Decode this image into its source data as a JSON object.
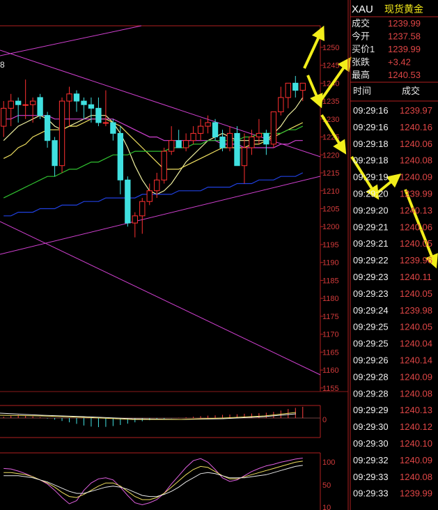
{
  "header": {
    "symbol": "XAU",
    "name": "现货黄金"
  },
  "quote": [
    {
      "label": "成交",
      "value": "1239.99"
    },
    {
      "label": "今开",
      "value": "1237.58"
    },
    {
      "label": "买价1",
      "value": "1239.99"
    },
    {
      "label": "张跌",
      "value": "+3.42"
    },
    {
      "label": "最高",
      "value": "1240.53"
    }
  ],
  "trades_header": {
    "time": "时间",
    "price": "成交"
  },
  "trades": [
    {
      "time": "09:29:16",
      "price": "1239.97"
    },
    {
      "time": "09:29:16",
      "price": "1240.16"
    },
    {
      "time": "09:29:18",
      "price": "1240.06"
    },
    {
      "time": "09:29:18",
      "price": "1240.08"
    },
    {
      "time": "09:29:19",
      "price": "1240.09"
    },
    {
      "time": "09:29:20",
      "price": "1239.99"
    },
    {
      "time": "09:29:20",
      "price": "1240.13"
    },
    {
      "time": "09:29:21",
      "price": "1240.06"
    },
    {
      "time": "09:29:21",
      "price": "1240.05"
    },
    {
      "time": "09:29:22",
      "price": "1239.96"
    },
    {
      "time": "09:29:23",
      "price": "1240.11"
    },
    {
      "time": "09:29:23",
      "price": "1240.05"
    },
    {
      "time": "09:29:24",
      "price": "1239.98"
    },
    {
      "time": "09:29:25",
      "price": "1240.05"
    },
    {
      "time": "09:29:25",
      "price": "1240.04"
    },
    {
      "time": "09:29:26",
      "price": "1240.14"
    },
    {
      "time": "09:29:28",
      "price": "1240.09"
    },
    {
      "time": "09:29:28",
      "price": "1240.08"
    },
    {
      "time": "09:29:29",
      "price": "1240.13"
    },
    {
      "time": "09:29:30",
      "price": "1240.12"
    },
    {
      "time": "09:29:30",
      "price": "1240.10"
    },
    {
      "time": "09:29:32",
      "price": "1240.09"
    },
    {
      "time": "09:29:33",
      "price": "1240.08"
    },
    {
      "time": "09:29:33",
      "price": "1239.99"
    }
  ],
  "chart_data": [
    {
      "type": "candlestick",
      "price_axis": {
        "ylim": [
          1154,
          1256
        ],
        "ticks": [
          "1250",
          "1245",
          "1240",
          "1235",
          "1230",
          "1225",
          "1220",
          "1215",
          "1210",
          "1205",
          "1200",
          "1195",
          "1190",
          "1185",
          "1180",
          "1175",
          "1170",
          "1165",
          "1160",
          "1155"
        ],
        "tick_values": [
          1250,
          1245,
          1240,
          1235,
          1230,
          1225,
          1220,
          1215,
          1210,
          1205,
          1200,
          1195,
          1190,
          1185,
          1180,
          1175,
          1170,
          1165,
          1160,
          1155
        ]
      },
      "partial_label": "8",
      "candles": [
        {
          "o": 1228,
          "h": 1235,
          "l": 1225,
          "c": 1233
        },
        {
          "o": 1233,
          "h": 1237,
          "l": 1228,
          "c": 1235
        },
        {
          "o": 1235,
          "h": 1236,
          "l": 1229,
          "c": 1234
        },
        {
          "o": 1234,
          "h": 1241,
          "l": 1230,
          "c": 1234
        },
        {
          "o": 1234,
          "h": 1236,
          "l": 1229,
          "c": 1235
        },
        {
          "o": 1236,
          "h": 1237,
          "l": 1230,
          "c": 1231
        },
        {
          "o": 1231,
          "h": 1232,
          "l": 1222,
          "c": 1224
        },
        {
          "o": 1224,
          "h": 1225,
          "l": 1214,
          "c": 1217
        },
        {
          "o": 1217,
          "h": 1236,
          "l": 1215,
          "c": 1235
        },
        {
          "o": 1235,
          "h": 1239,
          "l": 1228,
          "c": 1237
        },
        {
          "o": 1237,
          "h": 1238,
          "l": 1232,
          "c": 1235
        },
        {
          "o": 1235,
          "h": 1236,
          "l": 1230,
          "c": 1234
        },
        {
          "o": 1234,
          "h": 1236,
          "l": 1229,
          "c": 1233
        },
        {
          "o": 1233,
          "h": 1236,
          "l": 1228,
          "c": 1229
        },
        {
          "o": 1229,
          "h": 1238,
          "l": 1228,
          "c": 1229
        },
        {
          "o": 1229,
          "h": 1230,
          "l": 1224,
          "c": 1226
        },
        {
          "o": 1226,
          "h": 1228,
          "l": 1209,
          "c": 1213
        },
        {
          "o": 1213,
          "h": 1214,
          "l": 1200,
          "c": 1201
        },
        {
          "o": 1201,
          "h": 1204,
          "l": 1197,
          "c": 1203
        },
        {
          "o": 1203,
          "h": 1208,
          "l": 1198,
          "c": 1207
        },
        {
          "o": 1207,
          "h": 1212,
          "l": 1206,
          "c": 1210
        },
        {
          "o": 1210,
          "h": 1215,
          "l": 1208,
          "c": 1213
        },
        {
          "o": 1213,
          "h": 1222,
          "l": 1212,
          "c": 1221
        },
        {
          "o": 1221,
          "h": 1228,
          "l": 1220,
          "c": 1224
        },
        {
          "o": 1224,
          "h": 1227,
          "l": 1222,
          "c": 1222
        },
        {
          "o": 1222,
          "h": 1226,
          "l": 1221,
          "c": 1224
        },
        {
          "o": 1224,
          "h": 1228,
          "l": 1223,
          "c": 1226
        },
        {
          "o": 1226,
          "h": 1230,
          "l": 1224,
          "c": 1228
        },
        {
          "o": 1228,
          "h": 1231,
          "l": 1226,
          "c": 1229
        },
        {
          "o": 1229,
          "h": 1230,
          "l": 1224,
          "c": 1225
        },
        {
          "o": 1225,
          "h": 1227,
          "l": 1221,
          "c": 1222
        },
        {
          "o": 1222,
          "h": 1228,
          "l": 1221,
          "c": 1226
        },
        {
          "o": 1226,
          "h": 1228,
          "l": 1217,
          "c": 1217
        },
        {
          "o": 1217,
          "h": 1226,
          "l": 1212,
          "c": 1222
        },
        {
          "o": 1222,
          "h": 1227,
          "l": 1220,
          "c": 1225
        },
        {
          "o": 1225,
          "h": 1230,
          "l": 1223,
          "c": 1226
        },
        {
          "o": 1226,
          "h": 1227,
          "l": 1220,
          "c": 1223
        },
        {
          "o": 1223,
          "h": 1232,
          "l": 1222,
          "c": 1232
        },
        {
          "o": 1232,
          "h": 1239,
          "l": 1231,
          "c": 1236
        },
        {
          "o": 1236,
          "h": 1240,
          "l": 1233,
          "c": 1240
        },
        {
          "o": 1240,
          "h": 1242,
          "l": 1236,
          "c": 1238
        },
        {
          "o": 1238,
          "h": 1240,
          "l": 1235,
          "c": 1240
        }
      ],
      "moving_averages": [
        {
          "color": "#f0f0a0",
          "values": [
            1224,
            1226,
            1228,
            1229,
            1230,
            1231,
            1230,
            1228,
            1227,
            1228,
            1229,
            1230,
            1231,
            1231,
            1231,
            1229,
            1226,
            1222,
            1217,
            1213,
            1210,
            1209,
            1210,
            1212,
            1215,
            1218,
            1220,
            1222,
            1224,
            1225,
            1226,
            1225,
            1224,
            1224,
            1224,
            1224,
            1224,
            1226,
            1228,
            1231,
            1233,
            1236
          ]
        },
        {
          "color": "#f0e060",
          "values": [
            1219,
            1220,
            1222,
            1223,
            1225,
            1226,
            1227,
            1227,
            1227,
            1228,
            1228,
            1229,
            1230,
            1230,
            1230,
            1229,
            1228,
            1226,
            1224,
            1222,
            1220,
            1218,
            1216,
            1216,
            1216,
            1217,
            1218,
            1219,
            1220,
            1221,
            1222,
            1222,
            1222,
            1222,
            1223,
            1223,
            1224,
            1225,
            1226,
            1227,
            1228,
            1229
          ]
        },
        {
          "color": "#d040d0",
          "values": [
            1230,
            1230,
            1231,
            1231,
            1231,
            1231,
            1231,
            1230,
            1230,
            1230,
            1230,
            1230,
            1230,
            1230,
            1230,
            1230,
            1229,
            1228,
            1227,
            1226,
            1225,
            1225,
            1224,
            1224,
            1224,
            1224,
            1224,
            1224,
            1224,
            1224,
            1223,
            1223,
            1223,
            1222,
            1222,
            1222,
            1222,
            1222,
            1223,
            1223,
            1224,
            1224
          ]
        },
        {
          "color": "#30c030",
          "values": [
            1208,
            1209,
            1210,
            1211,
            1212,
            1213,
            1214,
            1214,
            1215,
            1216,
            1216,
            1217,
            1218,
            1218,
            1219,
            1220,
            1220,
            1220,
            1221,
            1221,
            1221,
            1221,
            1221,
            1222,
            1222,
            1222,
            1223,
            1223,
            1224,
            1224,
            1224,
            1224,
            1224,
            1225,
            1225,
            1226,
            1226,
            1226,
            1226,
            1227,
            1227,
            1228
          ]
        },
        {
          "color": "#2040e0",
          "values": [
            1203,
            1203,
            1204,
            1204,
            1204,
            1205,
            1205,
            1205,
            1206,
            1206,
            1206,
            1207,
            1207,
            1207,
            1208,
            1208,
            1208,
            1208,
            1208,
            1209,
            1209,
            1209,
            1209,
            1209,
            1210,
            1210,
            1210,
            1210,
            1211,
            1211,
            1211,
            1211,
            1212,
            1212,
            1212,
            1213,
            1213,
            1213,
            1214,
            1214,
            1214,
            1215
          ]
        }
      ]
    },
    {
      "type": "bar",
      "title": "",
      "ylabel_ticks": [
        "0"
      ],
      "ylim": [
        -6,
        6
      ],
      "values": [
        0.5,
        0.8,
        1.2,
        0.9,
        0.6,
        0.3,
        -0.2,
        -0.6,
        -1.1,
        -1.6,
        -2.2,
        -2.8,
        -3.2,
        -3.4,
        -3.3,
        -3.0,
        -2.6,
        -2.1,
        -1.6,
        -1.2,
        -0.8,
        -0.5,
        -0.3,
        -0.1,
        0.1,
        0.3,
        0.5,
        0.7,
        0.9,
        1.0,
        1.2,
        1.3,
        1.4,
        1.6,
        1.7,
        1.8,
        2.0,
        2.3,
        2.8,
        3.4,
        3.8,
        4.2
      ]
    },
    {
      "type": "line",
      "title": "",
      "yticks": [
        "100",
        "50",
        "10"
      ],
      "ylim": [
        0,
        110
      ],
      "series": [
        {
          "color": "#e060e0",
          "values": [
            80,
            79,
            75,
            70,
            64,
            58,
            50,
            38,
            24,
            12,
            18,
            38,
            52,
            60,
            62,
            58,
            44,
            28,
            14,
            10,
            14,
            20,
            32,
            50,
            66,
            82,
            95,
            99,
            92,
            78,
            62,
            55,
            58,
            66,
            74,
            80,
            85,
            88,
            92,
            95,
            98,
            100
          ]
        },
        {
          "color": "#f0e060",
          "values": [
            72,
            72,
            70,
            68,
            64,
            58,
            52,
            44,
            34,
            26,
            24,
            30,
            38,
            46,
            52,
            52,
            46,
            36,
            26,
            20,
            20,
            24,
            32,
            44,
            56,
            68,
            78,
            84,
            82,
            74,
            66,
            60,
            60,
            64,
            68,
            72,
            76,
            80,
            84,
            88,
            92,
            94
          ]
        },
        {
          "color": "#e8e8e8",
          "values": [
            66,
            66,
            66,
            64,
            62,
            58,
            54,
            48,
            42,
            36,
            32,
            32,
            36,
            40,
            44,
            46,
            44,
            40,
            34,
            28,
            26,
            26,
            30,
            36,
            44,
            54,
            62,
            70,
            72,
            70,
            66,
            62,
            62,
            62,
            64,
            66,
            68,
            72,
            76,
            80,
            84,
            86
          ]
        }
      ]
    }
  ]
}
